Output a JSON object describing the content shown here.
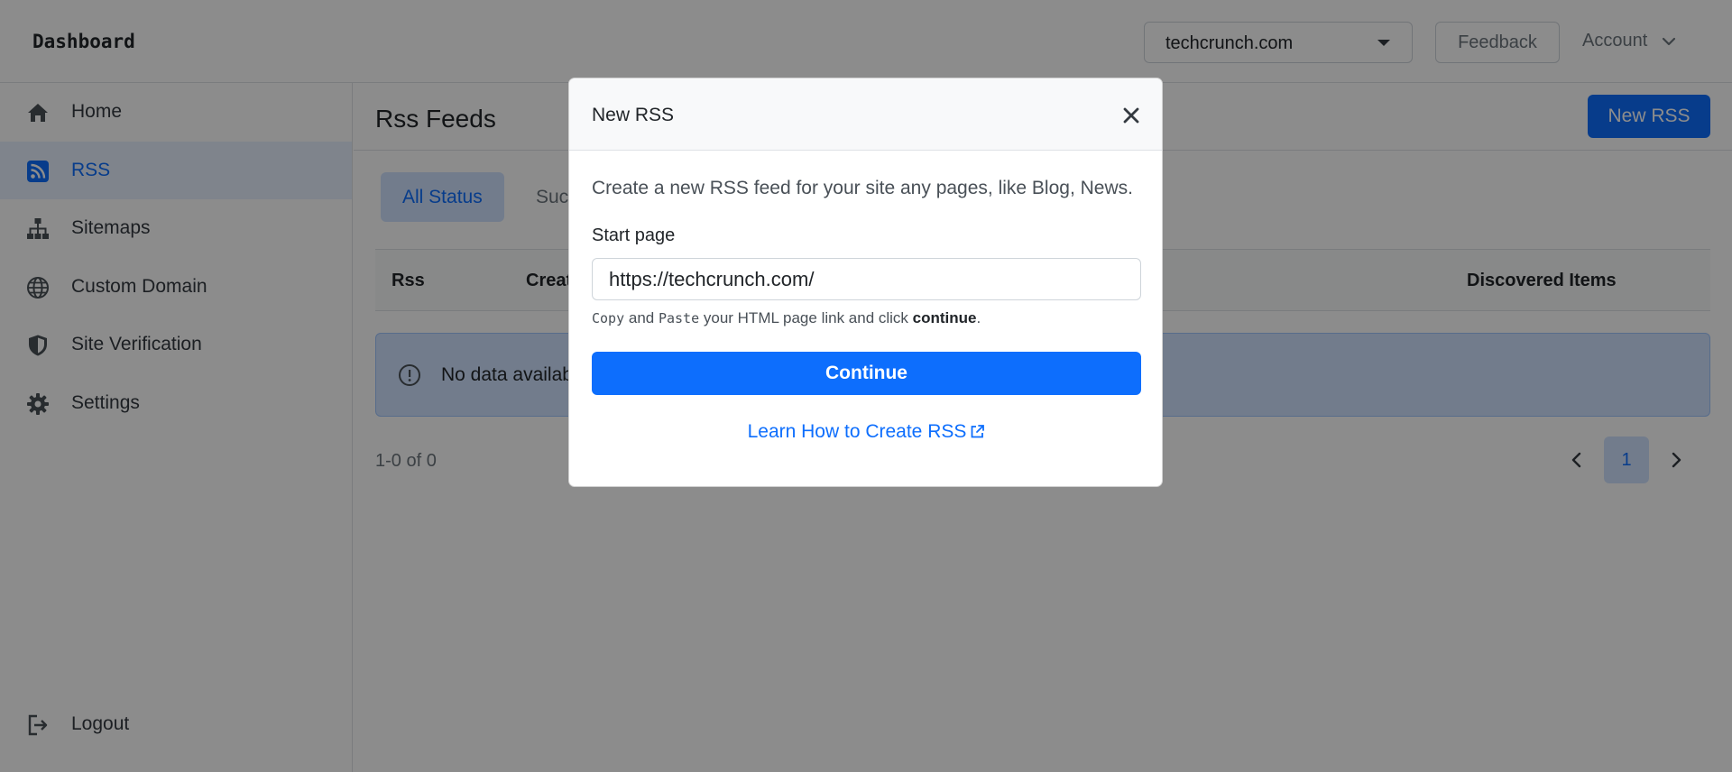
{
  "header": {
    "brand": "Dashboard",
    "site_select_value": "techcrunch.com",
    "feedback_label": "Feedback",
    "account_label": "Account"
  },
  "sidebar": {
    "items": [
      {
        "label": "Home",
        "icon": "home-icon",
        "active": false
      },
      {
        "label": "RSS",
        "icon": "rss-icon",
        "active": true
      },
      {
        "label": "Sitemaps",
        "icon": "sitemap-icon",
        "active": false
      },
      {
        "label": "Custom Domain",
        "icon": "globe-icon",
        "active": false
      },
      {
        "label": "Site Verification",
        "icon": "shield-icon",
        "active": false
      },
      {
        "label": "Settings",
        "icon": "gear-icon",
        "active": false
      }
    ],
    "logout_label": "Logout"
  },
  "main": {
    "title": "Rss Feeds",
    "new_button_label": "New RSS",
    "tabs": [
      {
        "label": "All Status",
        "active": true
      },
      {
        "label": "Succ",
        "active": false
      }
    ],
    "table": {
      "headers": [
        "Rss",
        "Creat",
        "Discovered Items"
      ]
    },
    "empty_message": "No data availab",
    "range_text": "1-0 of 0",
    "current_page": "1"
  },
  "modal": {
    "title": "New RSS",
    "description": "Create a new RSS feed for your site any pages, like Blog, News.",
    "field_label": "Start page",
    "field_value": "https://techcrunch.com/",
    "hint": {
      "copy_word": "Copy",
      "and_word": "and",
      "paste_word": "Paste",
      "middle_text": "your HTML page link and click",
      "continue_word": "continue",
      "end_text": "."
    },
    "continue_label": "Continue",
    "learn_link_label": "Learn How to Create RSS"
  },
  "colors": {
    "accent": "#0d6efd",
    "active_bg": "#cfe2ff",
    "overlay": "rgba(0,0,0,0.45)"
  }
}
